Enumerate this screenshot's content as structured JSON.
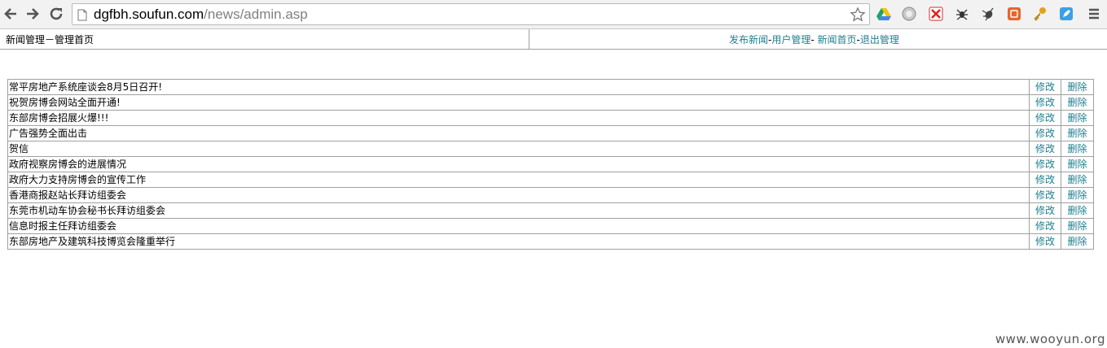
{
  "browser": {
    "url_domain": "dgfbh.soufun.com",
    "url_path": "/news/admin.asp"
  },
  "header": {
    "title": "新闻管理－管理首页",
    "links": [
      "发布新闻",
      "用户管理",
      "新闻首页",
      "退出管理"
    ],
    "separators": [
      "-",
      "- ",
      "-"
    ]
  },
  "news": {
    "items": [
      "常平房地产系统座谈会8月5日召开!",
      "祝贺房博会网站全面开通!",
      "东部房博会招展火爆!!!",
      "广告强势全面出击",
      "贺信",
      "政府视察房博会的进展情况",
      "政府大力支持房博会的宣传工作",
      "香港商报赵站长拜访组委会",
      "东莞市机动车协会秘书长拜访组委会",
      "信息时报主任拜访组委会",
      "东部房地产及建筑科技博览会隆重举行"
    ],
    "edit_label": "修改",
    "delete_label": "删除"
  },
  "watermark": "www.wooyun.org",
  "colors": {
    "link": "#1e7f8f",
    "border": "#a0a0a0"
  }
}
